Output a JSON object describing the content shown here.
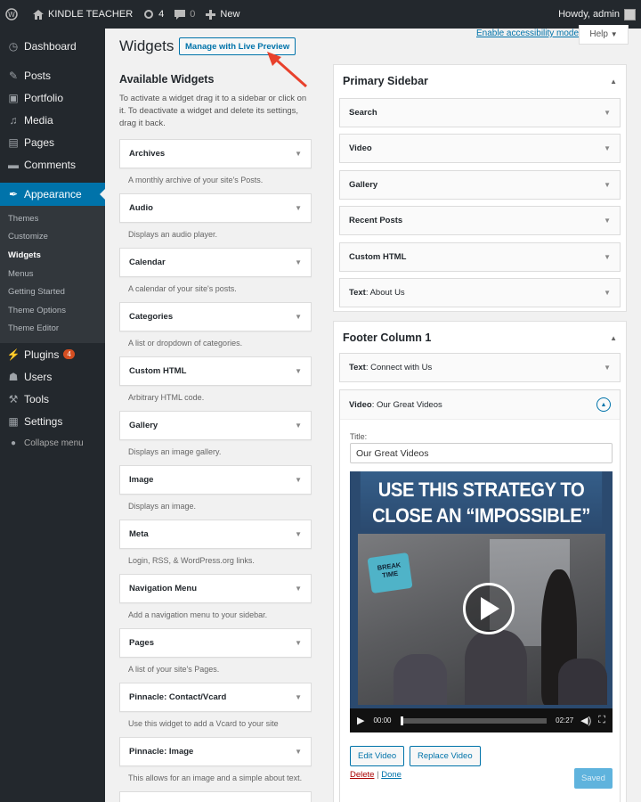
{
  "adminbar": {
    "site_name": "KINDLE TEACHER",
    "updates_count": "4",
    "comments_count": "0",
    "new_label": "New",
    "greeting": "Howdy, admin"
  },
  "sidebar": {
    "items_top": [
      {
        "label": "Dashboard",
        "icon": "dashboard-icon"
      },
      {
        "label": "Posts",
        "icon": "pin-icon"
      },
      {
        "label": "Portfolio",
        "icon": "portfolio-icon"
      },
      {
        "label": "Media",
        "icon": "media-icon"
      },
      {
        "label": "Pages",
        "icon": "pages-icon"
      },
      {
        "label": "Comments",
        "icon": "comments-icon"
      }
    ],
    "active": {
      "label": "Appearance",
      "icon": "brush-icon"
    },
    "submenu": [
      "Themes",
      "Customize",
      "Widgets",
      "Menus",
      "Getting Started",
      "Theme Options",
      "Theme Editor"
    ],
    "current_sub": "Widgets",
    "items_bottom": [
      {
        "label": "Plugins",
        "icon": "plugin-icon",
        "badge": "4"
      },
      {
        "label": "Users",
        "icon": "users-icon"
      },
      {
        "label": "Tools",
        "icon": "wrench-icon"
      },
      {
        "label": "Settings",
        "icon": "settings-icon"
      }
    ],
    "collapse_label": "Collapse menu"
  },
  "header": {
    "title": "Widgets",
    "live_preview": "Manage with Live Preview",
    "accessibility_link": "Enable accessibility mode",
    "help": "Help"
  },
  "available": {
    "title": "Available Widgets",
    "description": "To activate a widget drag it to a sidebar or click on it. To deactivate a widget and delete its settings, drag it back.",
    "widgets": [
      {
        "name": "Archives",
        "desc": "A monthly archive of your site's Posts."
      },
      {
        "name": "Audio",
        "desc": "Displays an audio player."
      },
      {
        "name": "Calendar",
        "desc": "A calendar of your site's posts."
      },
      {
        "name": "Categories",
        "desc": "A list or dropdown of categories."
      },
      {
        "name": "Custom HTML",
        "desc": "Arbitrary HTML code."
      },
      {
        "name": "Gallery",
        "desc": "Displays an image gallery."
      },
      {
        "name": "Image",
        "desc": "Displays an image."
      },
      {
        "name": "Meta",
        "desc": "Login, RSS, & WordPress.org links."
      },
      {
        "name": "Navigation Menu",
        "desc": "Add a navigation menu to your sidebar."
      },
      {
        "name": "Pages",
        "desc": "A list of your site's Pages."
      },
      {
        "name": "Pinnacle: Contact/Vcard",
        "desc": "Use this widget to add a Vcard to your site"
      },
      {
        "name": "Pinnacle: Image",
        "desc": "This allows for an image and a simple about text."
      }
    ]
  },
  "primary_sidebar": {
    "title": "Primary Sidebar",
    "widgets": [
      {
        "name": "Search",
        "sub": ""
      },
      {
        "name": "Video",
        "sub": ""
      },
      {
        "name": "Gallery",
        "sub": ""
      },
      {
        "name": "Recent Posts",
        "sub": ""
      },
      {
        "name": "Custom HTML",
        "sub": ""
      },
      {
        "name": "Text",
        "sub": ": About Us"
      }
    ]
  },
  "footer_column": {
    "title": "Footer Column 1",
    "collapsed_widget": {
      "name": "Text",
      "sub": ": Connect with Us"
    },
    "expanded_widget": {
      "name": "Video",
      "sub": ": Our Great Videos",
      "field_label": "Title:",
      "field_value": "Our Great Videos",
      "video_headline_1": "USE THIS STRATEGY TO",
      "video_headline_2": "CLOSE AN “IMPOSSIBLE” DEAL",
      "mug_text_1": "BREAK",
      "mug_text_2": "TIME",
      "time_current": "00:00",
      "time_total": "02:27",
      "progress": 0,
      "edit_label": "Edit Video",
      "replace_label": "Replace Video",
      "delete_label": "Delete",
      "separator": "|",
      "done_label": "Done",
      "saved_label": "Saved"
    }
  },
  "colors": {
    "admin_dark": "#23282d",
    "accent": "#0073aa",
    "annotation_arrow": "#e8412c"
  }
}
